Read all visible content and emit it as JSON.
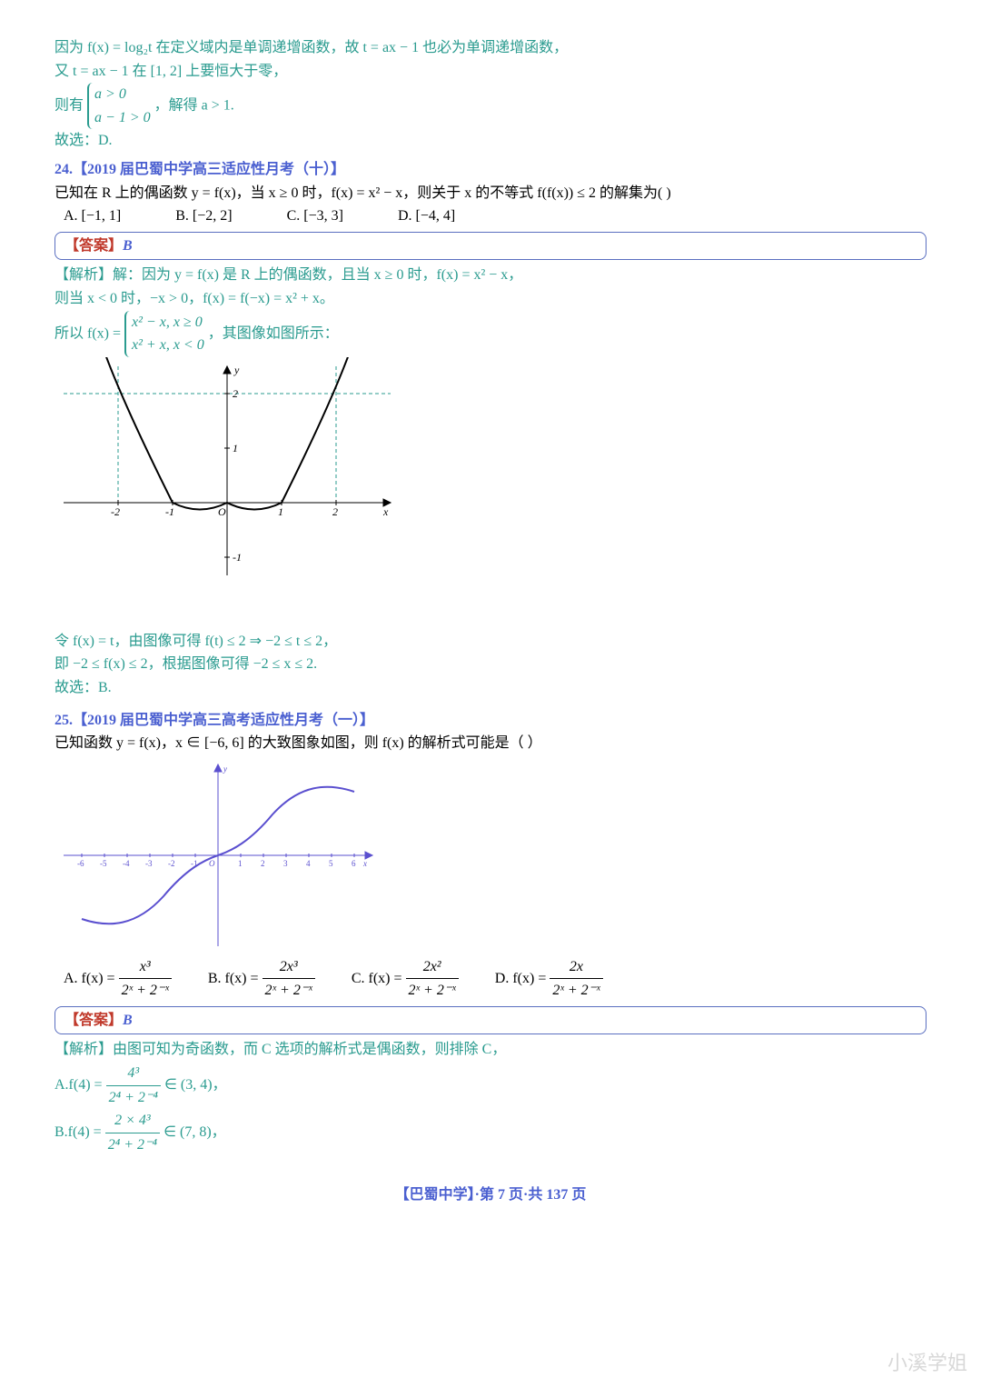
{
  "prev_solution": {
    "line1": "因为 f(x) = log₂t 在定义域内是单调递增函数，故 t = ax − 1 也必为单调递增函数，",
    "line2": "又 t = ax − 1 在 [1, 2] 上要恒大于零，",
    "line3_pre": "则有 ",
    "case1": "a > 0",
    "case2": "a − 1 > 0",
    "line3_post": " ，解得 a > 1.",
    "line4": "故选：D."
  },
  "q24": {
    "num": "24.",
    "source": "【2019 届巴蜀中学高三适应性月考（十）】",
    "stem": "已知在 R 上的偶函数 y = f(x)，当 x ≥ 0 时，f(x) = x² − x，则关于 x 的不等式 f(f(x)) ≤ 2 的解集为(    )",
    "options": {
      "A": "A. [−1, 1]",
      "B": "B. [−2, 2]",
      "C": "C. [−3, 3]",
      "D": "D. [−4, 4]"
    },
    "answer_label": "【答案】",
    "answer": "B",
    "sol": {
      "l1": "【解析】解：因为 y = f(x) 是 R 上的偶函数，且当 x ≥ 0 时，f(x) = x² − x，",
      "l2": "则当 x < 0 时，−x > 0，f(x) = f(−x) = x² + x。",
      "l3_pre": "所以 f(x) = ",
      "case1": "x² − x, x ≥ 0",
      "case2": "x² + x, x < 0",
      "l3_post": " ，其图像如图所示：",
      "l4": "令 f(x) = t，由图像可得 f(t) ≤ 2 ⇒ −2 ≤ t ≤ 2，",
      "l5": "即 −2 ≤ f(x) ≤ 2，根据图像可得 −2 ≤ x ≤ 2.",
      "l6": "故选：B."
    }
  },
  "q25": {
    "num": "25.",
    "source": "【2019 届巴蜀中学高三高考适应性月考（一）】",
    "stem": "已知函数 y = f(x)，x ∈ [−6, 6] 的大致图象如图，则 f(x) 的解析式可能是（ ）",
    "options": {
      "A_pre": "A. f(x) = ",
      "A_num": "x³",
      "A_den": "2ˣ + 2⁻ˣ",
      "B_pre": "B. f(x) = ",
      "B_num": "2x³",
      "B_den": "2ˣ + 2⁻ˣ",
      "C_pre": "C. f(x) = ",
      "C_num": "2x²",
      "C_den": "2ˣ + 2⁻ˣ",
      "D_pre": "D. f(x) = ",
      "D_num": "2x",
      "D_den": "2ˣ + 2⁻ˣ"
    },
    "answer_label": "【答案】",
    "answer": "B",
    "sol": {
      "l1": "【解析】由图可知为奇函数，而 C 选项的解析式是偶函数，则排除 C，",
      "l2_pre": "A.f(4) = ",
      "l2_num": "4³",
      "l2_den": "2⁴ + 2⁻⁴",
      "l2_post": " ∈ (3, 4)，",
      "l3_pre": "B.f(4) = ",
      "l3_num": "2 × 4³",
      "l3_den": "2⁴ + 2⁻⁴",
      "l3_post": " ∈ (7, 8)，"
    }
  },
  "footer": "【巴蜀中学】·第 7 页·共 137 页",
  "watermark": "小溪学姐",
  "chart_data": [
    {
      "type": "line",
      "title": "f(x) piecewise graph (Q24)",
      "xlabel": "x",
      "ylabel": "y",
      "xlim": [
        -3,
        3
      ],
      "ylim": [
        -1.5,
        2.5
      ],
      "series": [
        {
          "name": "f(x)=x²+x (x<0)",
          "x": [
            -2,
            -1.5,
            -1,
            -0.5,
            0
          ],
          "values": [
            2,
            0.75,
            0,
            -0.25,
            0
          ]
        },
        {
          "name": "f(x)=x²−x (x≥0)",
          "x": [
            0,
            0.5,
            1,
            1.5,
            2
          ],
          "values": [
            0,
            -0.25,
            0,
            0.75,
            2
          ]
        }
      ],
      "annotations": [
        "dashed y=2",
        "ticks -2,-1,1,2 on x",
        "ticks 1,2,-1 on y"
      ]
    },
    {
      "type": "line",
      "title": "y=f(x) on [-6,6] (Q25)",
      "xlabel": "x",
      "ylabel": "y",
      "xlim": [
        -6,
        6
      ],
      "ylim": [
        -9,
        9
      ],
      "series": [
        {
          "name": "f(x)",
          "x": [
            -6,
            -5,
            -4,
            -3,
            -2,
            -1,
            0,
            1,
            2,
            3,
            4,
            5,
            6
          ],
          "values": [
            -7,
            -7.8,
            -7.5,
            -6.5,
            -3.8,
            -0.8,
            0,
            0.8,
            3.8,
            6.5,
            7.5,
            7.8,
            7
          ]
        }
      ],
      "annotations": [
        "odd function, sigmoid-like, passes through origin"
      ]
    }
  ]
}
